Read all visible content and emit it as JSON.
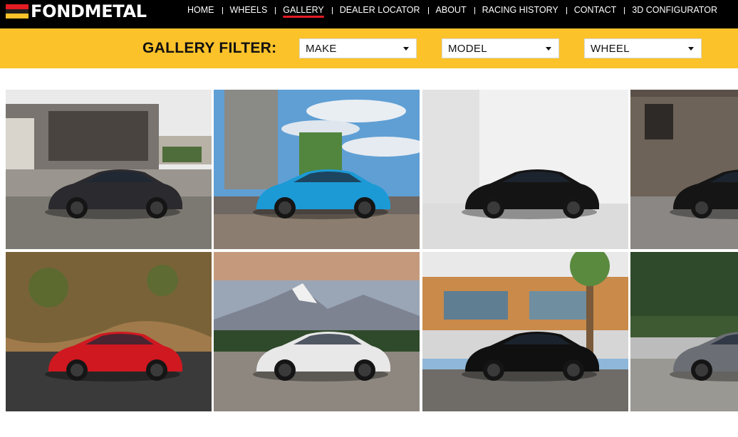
{
  "brand": {
    "name": "FONDMETAL",
    "flag_colors": [
      "#e41b23",
      "#1f1f1f",
      "#fcc22a"
    ]
  },
  "nav": {
    "items": [
      {
        "label": "HOME",
        "id": "home"
      },
      {
        "label": "WHEELS",
        "id": "wheels"
      },
      {
        "label": "GALLERY",
        "id": "gallery",
        "active": true
      },
      {
        "label": "DEALER LOCATOR",
        "id": "dealer-locator"
      },
      {
        "label": "ABOUT",
        "id": "about"
      },
      {
        "label": "RACING HISTORY",
        "id": "racing-history"
      },
      {
        "label": "CONTACT",
        "id": "contact"
      },
      {
        "label": "3D CONFIGURATOR",
        "id": "3d-configurator"
      }
    ]
  },
  "filter": {
    "title": "GALLERY FILTER:",
    "make": {
      "selected": "MAKE"
    },
    "model": {
      "selected": "MODEL"
    },
    "wheel": {
      "selected": "WHEEL"
    }
  },
  "colors": {
    "accent_yellow": "#fcc22a",
    "accent_red": "#e41b23",
    "nav_bg": "#000000"
  },
  "gallery": {
    "photos": [
      {
        "car_color": "#2b2a2e",
        "scene": "garage-driveway"
      },
      {
        "car_color": "#1c9ad6",
        "scene": "tower-sky"
      },
      {
        "car_color": "#141414",
        "scene": "white-studio"
      },
      {
        "car_color": "#151515",
        "scene": "wood-wall"
      },
      {
        "car_color": "#d01820",
        "scene": "hillside"
      },
      {
        "car_color": "#e8e8e8",
        "scene": "mountain-sunset"
      },
      {
        "car_color": "#101010",
        "scene": "modern-house"
      },
      {
        "car_color": "#6b6e74",
        "scene": "forest-lot"
      }
    ]
  }
}
